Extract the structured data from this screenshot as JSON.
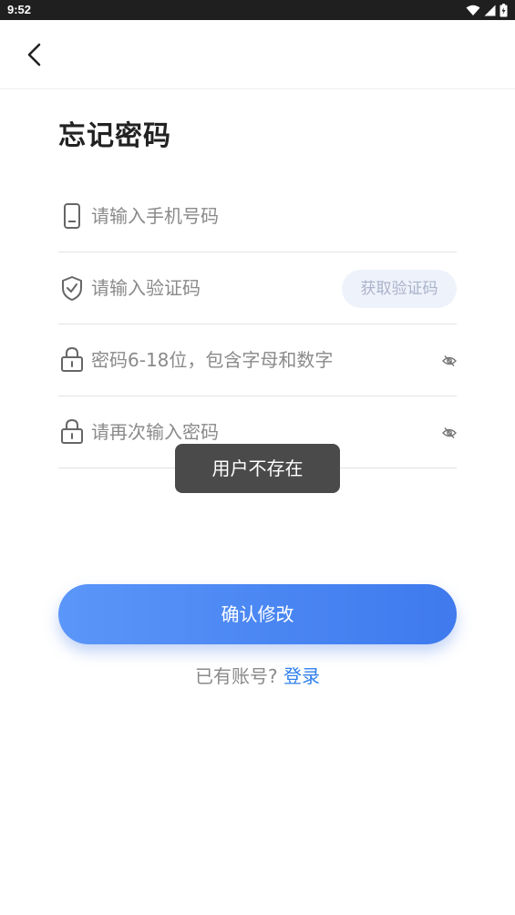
{
  "status_bar": {
    "time": "9:52",
    "icons": [
      "wifi-icon",
      "signal-icon",
      "battery-icon"
    ]
  },
  "toolbar": {
    "back_icon": "chevron-left-icon"
  },
  "page": {
    "title": "忘记密码"
  },
  "form": {
    "phone": {
      "placeholder": "请输入手机号码",
      "value": "",
      "icon": "phone-icon"
    },
    "code": {
      "placeholder": "请输入验证码",
      "value": "",
      "icon": "shield-check-icon",
      "get_code_label": "获取验证码"
    },
    "password": {
      "placeholder": "密码6-18位，包含字母和数字",
      "value": "",
      "icon": "lock-icon",
      "toggle_icon": "eye-off-icon"
    },
    "confirm_password": {
      "placeholder": "请再次输入密码",
      "value": "",
      "icon": "lock-icon",
      "toggle_icon": "eye-off-icon"
    }
  },
  "toast": {
    "message": "用户不存在"
  },
  "actions": {
    "confirm_label": "确认修改"
  },
  "footer": {
    "question": "已有账号?",
    "login_link": "登录"
  },
  "colors": {
    "accent": "#2f80ed",
    "button_gradient_start": "#5b96f9",
    "button_gradient_end": "#3f7aee",
    "code_button_bg": "#eef2fb",
    "code_button_text": "#a9b3c9",
    "toast_bg": "#4a4a4a",
    "status_bar_bg": "#1f1f1f"
  }
}
